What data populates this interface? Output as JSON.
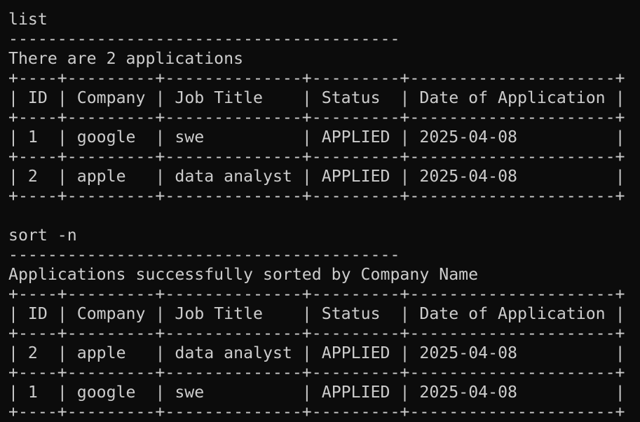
{
  "colors": {
    "background": "#0c0c0c",
    "foreground": "#cccccc"
  },
  "blocks": [
    {
      "command": "list",
      "separator": "----------------------------------------",
      "message": "There are 2 applications",
      "table": {
        "headers": [
          "ID",
          "Company",
          "Job Title",
          "Status",
          "Date of Application"
        ],
        "rows": [
          [
            "1",
            "google",
            "swe",
            "APPLIED",
            "2025-04-08"
          ],
          [
            "2",
            "apple",
            "data analyst",
            "APPLIED",
            "2025-04-08"
          ]
        ]
      }
    },
    {
      "command": "sort -n",
      "separator": "----------------------------------------",
      "message": "Applications successfully sorted by Company Name",
      "table": {
        "headers": [
          "ID",
          "Company",
          "Job Title",
          "Status",
          "Date of Application"
        ],
        "rows": [
          [
            "2",
            "apple",
            "data analyst",
            "APPLIED",
            "2025-04-08"
          ],
          [
            "1",
            "google",
            "swe",
            "APPLIED",
            "2025-04-08"
          ]
        ]
      }
    }
  ]
}
